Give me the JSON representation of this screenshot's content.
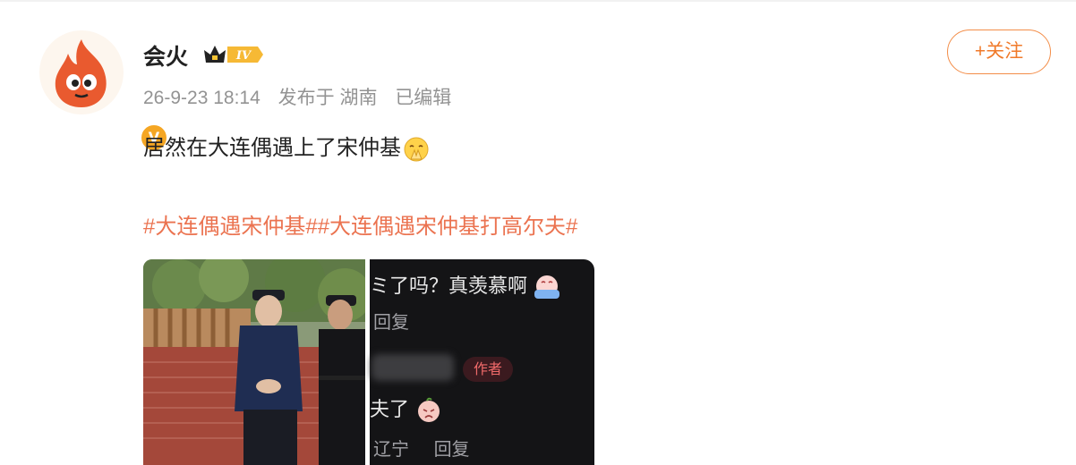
{
  "post": {
    "username": "会火",
    "level_badge": "IV",
    "date": "26-9-23 18:14",
    "published_from": "发布于 湖南",
    "edited": "已编辑",
    "follow_label": "+关注",
    "text": "居然在大连偶遇上了宋仲基",
    "hashtags": "#大连偶遇宋仲基##大连偶遇宋仲基打高尔夫#"
  },
  "screenshot": {
    "line1": "ミ了吗？真羡慕啊",
    "reply1": "回复",
    "author_tag": "作者",
    "line2": "夫了",
    "location": "辽宁",
    "reply2": "回复"
  },
  "colors": {
    "accent_orange": "#eb7350",
    "follow_orange": "#f07a2a",
    "meta_grey": "#939393"
  },
  "icons": [
    "flame-avatar-icon",
    "verified-v-icon",
    "crown-level-icon",
    "praying-emoji-icon",
    "crying-emoji-icon",
    "sad-emoji-icon"
  ]
}
